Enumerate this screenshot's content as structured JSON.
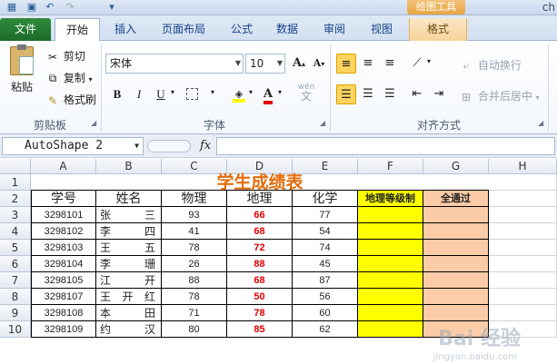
{
  "app_title": "ch",
  "context_tool": "绘图工具",
  "tabs": [
    "文件",
    "开始",
    "插入",
    "页面布局",
    "公式",
    "数据",
    "审阅",
    "视图",
    "格式"
  ],
  "clipboard": {
    "paste": "粘贴",
    "cut": "剪切",
    "copy": "复制",
    "format_painter": "格式刷",
    "group": "剪贴板"
  },
  "font": {
    "name": "宋体",
    "size": "10",
    "grow": "A",
    "shrink": "A",
    "bold": "B",
    "italic": "I",
    "underline": "U",
    "group": "字体",
    "wen": "wén"
  },
  "alignment": {
    "wrap": "自动换行",
    "merge": "合并后居中",
    "group": "对齐方式"
  },
  "formula_bar": {
    "name_box": "AutoShape 2",
    "fx": "fx",
    "formula": ""
  },
  "columns": [
    "A",
    "B",
    "C",
    "D",
    "E",
    "F",
    "G",
    "H"
  ],
  "rows": [
    "1",
    "2",
    "3",
    "4",
    "5",
    "6",
    "7",
    "8",
    "9",
    "10"
  ],
  "sheet": {
    "title": "学生成绩表",
    "headers": [
      "学号",
      "姓名",
      "物理",
      "地理",
      "化学",
      "地理等级制",
      "全通过"
    ],
    "records": [
      {
        "id": "3298101",
        "name": [
          "张",
          "三"
        ],
        "physics": "93",
        "geography": "66",
        "chemistry": "77"
      },
      {
        "id": "3298102",
        "name": [
          "李",
          "四"
        ],
        "physics": "41",
        "geography": "68",
        "chemistry": "54"
      },
      {
        "id": "3298103",
        "name": [
          "王",
          "五"
        ],
        "physics": "78",
        "geography": "72",
        "chemistry": "74"
      },
      {
        "id": "3298104",
        "name": [
          "李",
          "珊"
        ],
        "physics": "26",
        "geography": "88",
        "chemistry": "45"
      },
      {
        "id": "3298105",
        "name": [
          "江",
          "开"
        ],
        "physics": "88",
        "geography": "68",
        "chemistry": "87"
      },
      {
        "id": "3298107",
        "name": [
          "王",
          "开",
          "红"
        ],
        "physics": "78",
        "geography": "50",
        "chemistry": "56"
      },
      {
        "id": "3298108",
        "name": [
          "本",
          "田"
        ],
        "physics": "71",
        "geography": "78",
        "chemistry": "60"
      },
      {
        "id": "3298109",
        "name": [
          "约",
          "汉"
        ],
        "physics": "80",
        "geography": "85",
        "chemistry": "62"
      }
    ]
  },
  "watermark": {
    "brand": "Bai 经验",
    "sub": "jingyan.baidu.com"
  },
  "colors": {
    "title": "#e46c0a",
    "yellow": "#ffff00",
    "peach": "#fbcca7",
    "red": "#e00000",
    "file_tab": "#1d6a2a"
  }
}
